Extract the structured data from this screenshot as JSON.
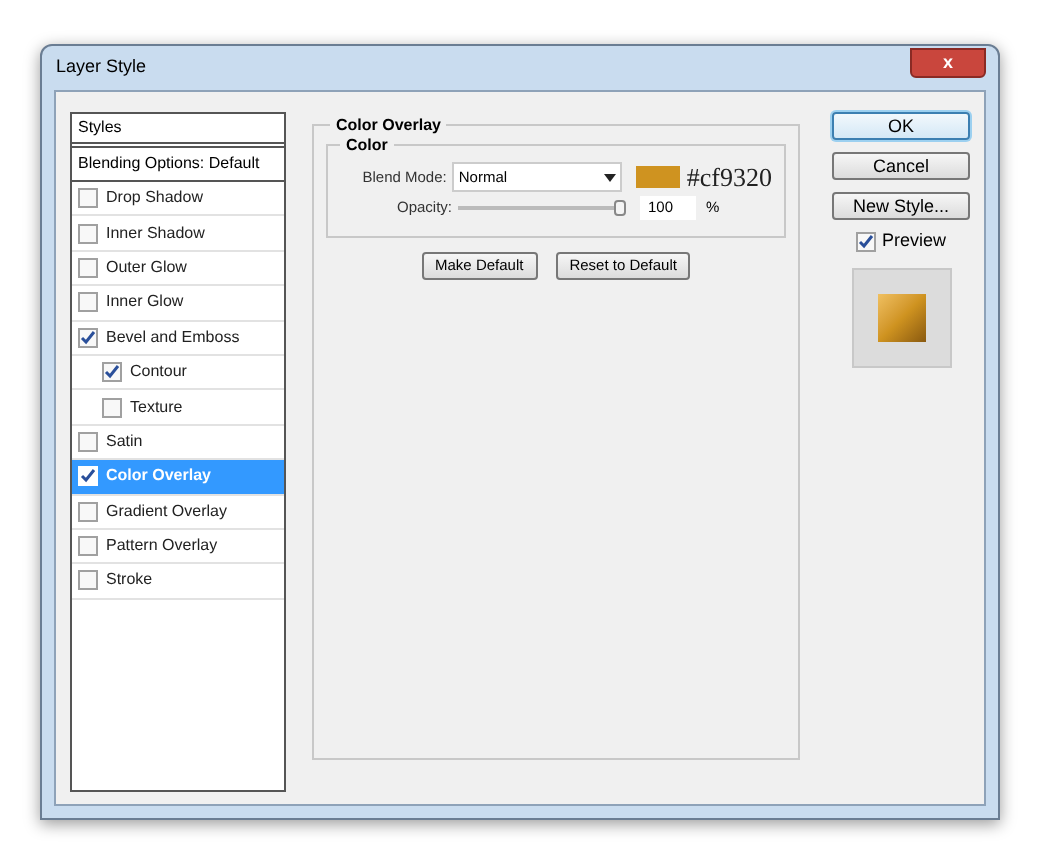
{
  "window": {
    "title": "Layer Style",
    "close_label": "x"
  },
  "sidebar": {
    "header": "Styles",
    "blending": "Blending Options: Default",
    "items": [
      {
        "label": "Drop Shadow",
        "checked": false,
        "selected": false
      },
      {
        "label": "Inner Shadow",
        "checked": false,
        "selected": false
      },
      {
        "label": "Outer Glow",
        "checked": false,
        "selected": false
      },
      {
        "label": "Inner Glow",
        "checked": false,
        "selected": false
      },
      {
        "label": "Bevel and Emboss",
        "checked": true,
        "selected": false,
        "children": [
          {
            "label": "Contour",
            "checked": true,
            "selected": false
          },
          {
            "label": "Texture",
            "checked": false,
            "selected": false
          }
        ]
      },
      {
        "label": "Satin",
        "checked": false,
        "selected": false
      },
      {
        "label": "Color Overlay",
        "checked": true,
        "selected": true
      },
      {
        "label": "Gradient Overlay",
        "checked": false,
        "selected": false
      },
      {
        "label": "Pattern Overlay",
        "checked": false,
        "selected": false
      },
      {
        "label": "Stroke",
        "checked": false,
        "selected": false
      }
    ]
  },
  "panel": {
    "title": "Color Overlay",
    "group": "Color",
    "blend_mode": {
      "label": "Blend Mode:",
      "value": "Normal"
    },
    "color": "#cf9320",
    "color_note": "#cf9320",
    "opacity": {
      "label": "Opacity:",
      "level": 1,
      "value": "100",
      "unit": "%"
    },
    "buttons": [
      "Make Default",
      "Reset to Default"
    ]
  },
  "actions": {
    "ok": "OK",
    "cancel": "Cancel",
    "new_style": "New Style...",
    "preview": {
      "label": "Preview",
      "checked": true
    }
  }
}
